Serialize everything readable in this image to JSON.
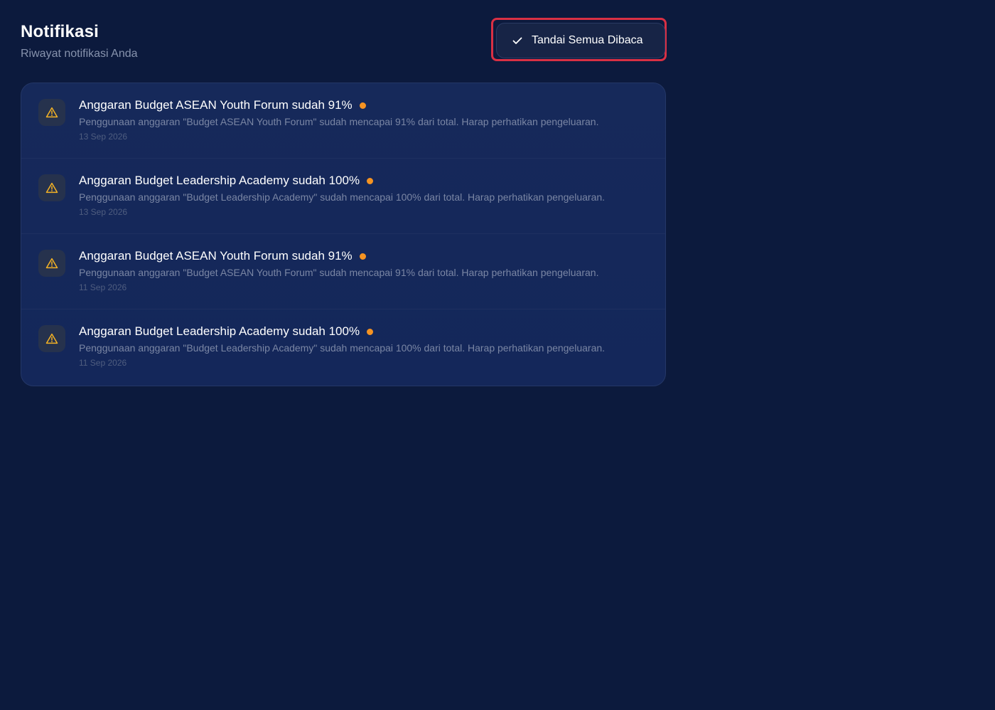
{
  "header": {
    "title": "Notifikasi",
    "subtitle": "Riwayat notifikasi Anda",
    "mark_all_label": "Tandai Semua Dibaca"
  },
  "notifications": [
    {
      "icon": "warning-icon",
      "title": "Anggaran Budget ASEAN Youth Forum sudah 91%",
      "body": "Penggunaan anggaran \"Budget ASEAN Youth Forum\" sudah mencapai 91% dari total. Harap perhatikan pengeluaran.",
      "date": "13 Sep 2026",
      "unread": true
    },
    {
      "icon": "warning-icon",
      "title": "Anggaran Budget Leadership Academy sudah 100%",
      "body": "Penggunaan anggaran \"Budget Leadership Academy\" sudah mencapai 100% dari total. Harap perhatikan pengeluaran.",
      "date": "13 Sep 2026",
      "unread": true
    },
    {
      "icon": "warning-icon",
      "title": "Anggaran Budget ASEAN Youth Forum sudah 91%",
      "body": "Penggunaan anggaran \"Budget ASEAN Youth Forum\" sudah mencapai 91% dari total. Harap perhatikan pengeluaran.",
      "date": "11 Sep 2026",
      "unread": true
    },
    {
      "icon": "warning-icon",
      "title": "Anggaran Budget Leadership Academy sudah 100%",
      "body": "Penggunaan anggaran \"Budget Leadership Academy\" sudah mencapai 100% dari total. Harap perhatikan pengeluaran.",
      "date": "11 Sep 2026",
      "unread": true
    }
  ],
  "colors": {
    "background": "#0c1a3d",
    "panel": "#16295a",
    "unread_dot": "#f59322",
    "warning_icon": "#f5b324",
    "highlight_outline": "#d93044"
  }
}
